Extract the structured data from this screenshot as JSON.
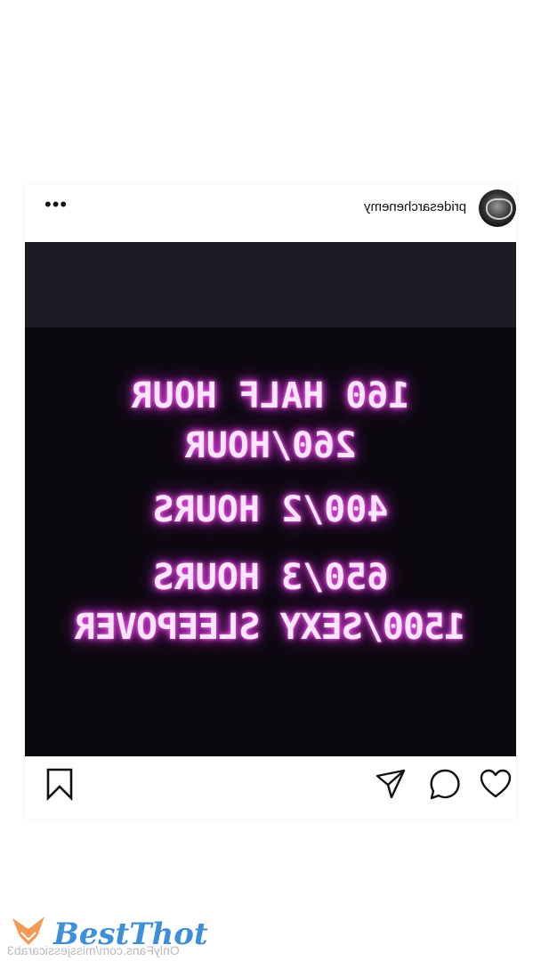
{
  "post": {
    "username": "pridesarchenemy",
    "more_label": "•••",
    "media_lines": [
      "160 HALF HOUR",
      "260/HOUR",
      "400/2 HOURS",
      "650/3 HOURS",
      "1500/SEXY SLEEPOVER"
    ]
  },
  "actions": {
    "icons": [
      "heart-icon",
      "comment-icon",
      "share-icon",
      "bookmark-icon"
    ]
  },
  "watermark": {
    "brand": "BestThot",
    "subtext": "OnlyFans.com/missjessicarab3"
  },
  "colors": {
    "neon": "#ff5cf2",
    "media_bg": "#0c0810",
    "watermark_blue": "#3e8fd8"
  }
}
